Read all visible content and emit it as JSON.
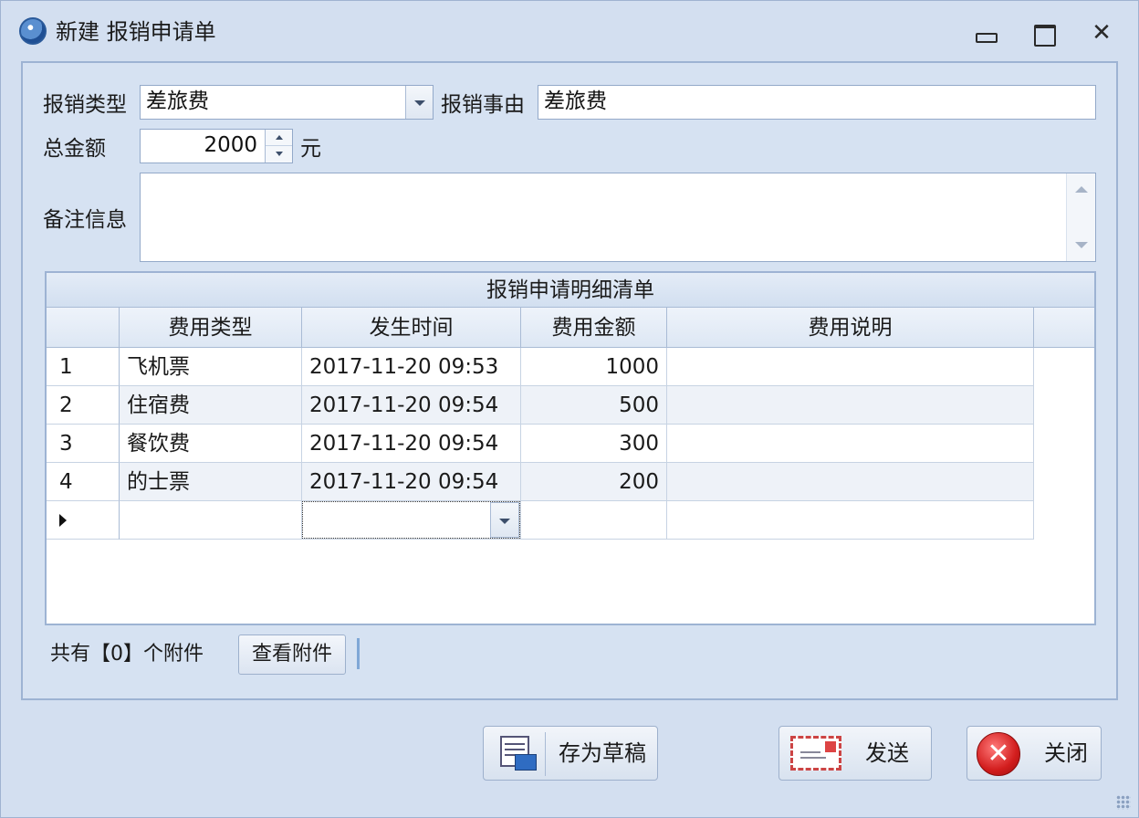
{
  "window": {
    "title": "新建 报销申请单",
    "controls": {
      "minimize": "minimize",
      "maximize": "maximize",
      "close": "✕"
    }
  },
  "form": {
    "type_label": "报销类型",
    "type_value": "差旅费",
    "reason_label": "报销事由",
    "reason_value": "差旅费",
    "amount_label": "总金额",
    "amount_value": "2000",
    "amount_unit": "元",
    "note_label": "备注信息",
    "note_value": ""
  },
  "grid": {
    "title": "报销申请明细清单",
    "columns": [
      "费用类型",
      "发生时间",
      "费用金额",
      "费用说明"
    ],
    "rows": [
      {
        "index": "1",
        "type": "飞机票",
        "time": "2017-11-20 09:53",
        "amount": "1000",
        "desc": ""
      },
      {
        "index": "2",
        "type": "住宿费",
        "time": "2017-11-20 09:54",
        "amount": "500",
        "desc": ""
      },
      {
        "index": "3",
        "type": "餐饮费",
        "time": "2017-11-20 09:54",
        "amount": "300",
        "desc": ""
      },
      {
        "index": "4",
        "type": "的士票",
        "time": "2017-11-20 09:54",
        "amount": "200",
        "desc": ""
      }
    ]
  },
  "attachments": {
    "prefix": "共有",
    "count_text": "【0】",
    "suffix": "个附件",
    "view_button": "查看附件"
  },
  "buttons": {
    "save_draft": "存为草稿",
    "send": "发送",
    "close": "关闭"
  },
  "colors": {
    "window_bg": "#d3dff0",
    "border": "#9db3d3",
    "close_red": "#d21d1d"
  }
}
